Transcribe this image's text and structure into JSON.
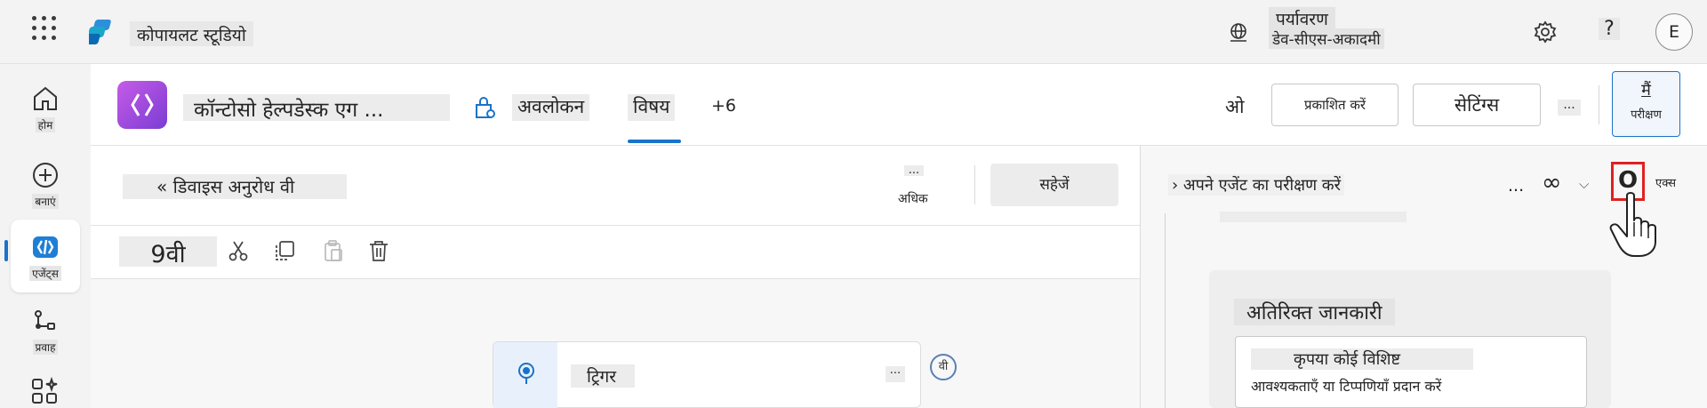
{
  "app": {
    "title": "कोपायलट स्टूडियो"
  },
  "environment": {
    "label": "पर्यावरण",
    "value": "डेव-सीएस-अकादमी"
  },
  "user": {
    "initial": "E"
  },
  "help_glyph": "?",
  "rail": {
    "home": "होम",
    "create": "बनाएं",
    "agents": "एजेंट्स",
    "flows": "प्रवाह"
  },
  "agent": {
    "name": "कॉन्टोसो हेल्पडेस्क एग ..."
  },
  "tabs": {
    "overview": "अवलोकन",
    "topics": "विषय",
    "more": "+6"
  },
  "header": {
    "truncated_label": "ओ",
    "publish": "प्रकाशित करें",
    "settings": "सेटिंग्स",
    "more": "...",
    "test_top": "मैं",
    "test_bottom": "परीक्षण"
  },
  "topic": {
    "title": "« डिवाइस अनुरोध वी",
    "more_dots": "...",
    "more_label": "अधिक",
    "save": "सहेजें"
  },
  "toolbar": {
    "zoom": "9वी"
  },
  "canvas": {
    "trigger_label": "ट्रिगर",
    "trigger_more": "...",
    "badge": "वी"
  },
  "test_panel": {
    "title": "› अपने एजेंट का परीक्षण करें",
    "more": "...",
    "infinity": "∞",
    "chevron": "⌵",
    "refresh": "O",
    "extra": "एक्स",
    "card_title": "अतिरिक्त जानकारी",
    "card_line1": "कृपया कोई विशिष्ट",
    "card_line2": "आवश्यकताएँ या टिप्पणियाँ प्रदान करें"
  },
  "icons": {
    "waffle": "waffle-icon",
    "globe": "globe-icon",
    "gear": "gear-icon",
    "home": "home-icon",
    "create": "plus-circle-icon",
    "agents": "agents-icon",
    "flows": "flow-icon",
    "cut": "scissors-icon",
    "copy": "copy-icon",
    "paste": "paste-icon",
    "delete": "trash-icon",
    "trigger": "trigger-icon"
  },
  "colors": {
    "accent": "#1a73c9",
    "agent_icon": "#9a4fe0",
    "highlight_box": "#e02020"
  }
}
